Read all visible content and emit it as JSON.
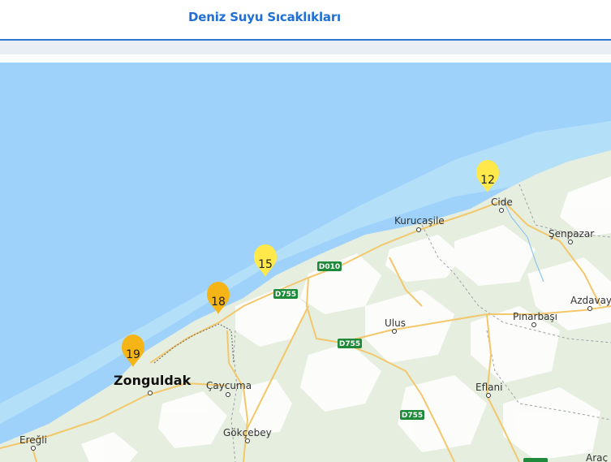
{
  "header": {
    "title": "Deniz Suyu Sıcaklıkları"
  },
  "colors": {
    "sea": "#9fd2fb",
    "coastal_sea": "#b4dff9",
    "land": "#e6eee0",
    "forest": "#ffffff",
    "accent": "#1f6fd6",
    "pin_yellow": "#ffe94a",
    "pin_orange": "#f6b516"
  },
  "markers": [
    {
      "value": "12",
      "color": "#ffe94a"
    },
    {
      "value": "15",
      "color": "#ffe94a"
    },
    {
      "value": "18",
      "color": "#f6b516"
    },
    {
      "value": "19",
      "color": "#f6b516"
    }
  ],
  "places": {
    "cide": "Cide",
    "kurucasile": "Kurucaşile",
    "senpazar": "Şenpazar",
    "azdavay": "Azdavay",
    "pinarbasi": "Pınarbaşı",
    "ulus": "Ulus",
    "zonguldak": "Zonguldak",
    "caycuma": "Çaycuma",
    "eflani": "Eflani",
    "gokcebey": "Gökçebey",
    "eregli": "Ereğli",
    "arac": "Araç"
  },
  "roads": {
    "d010": "D010",
    "d755_a": "D755",
    "d755_b": "D755",
    "d755_c": "D755"
  }
}
